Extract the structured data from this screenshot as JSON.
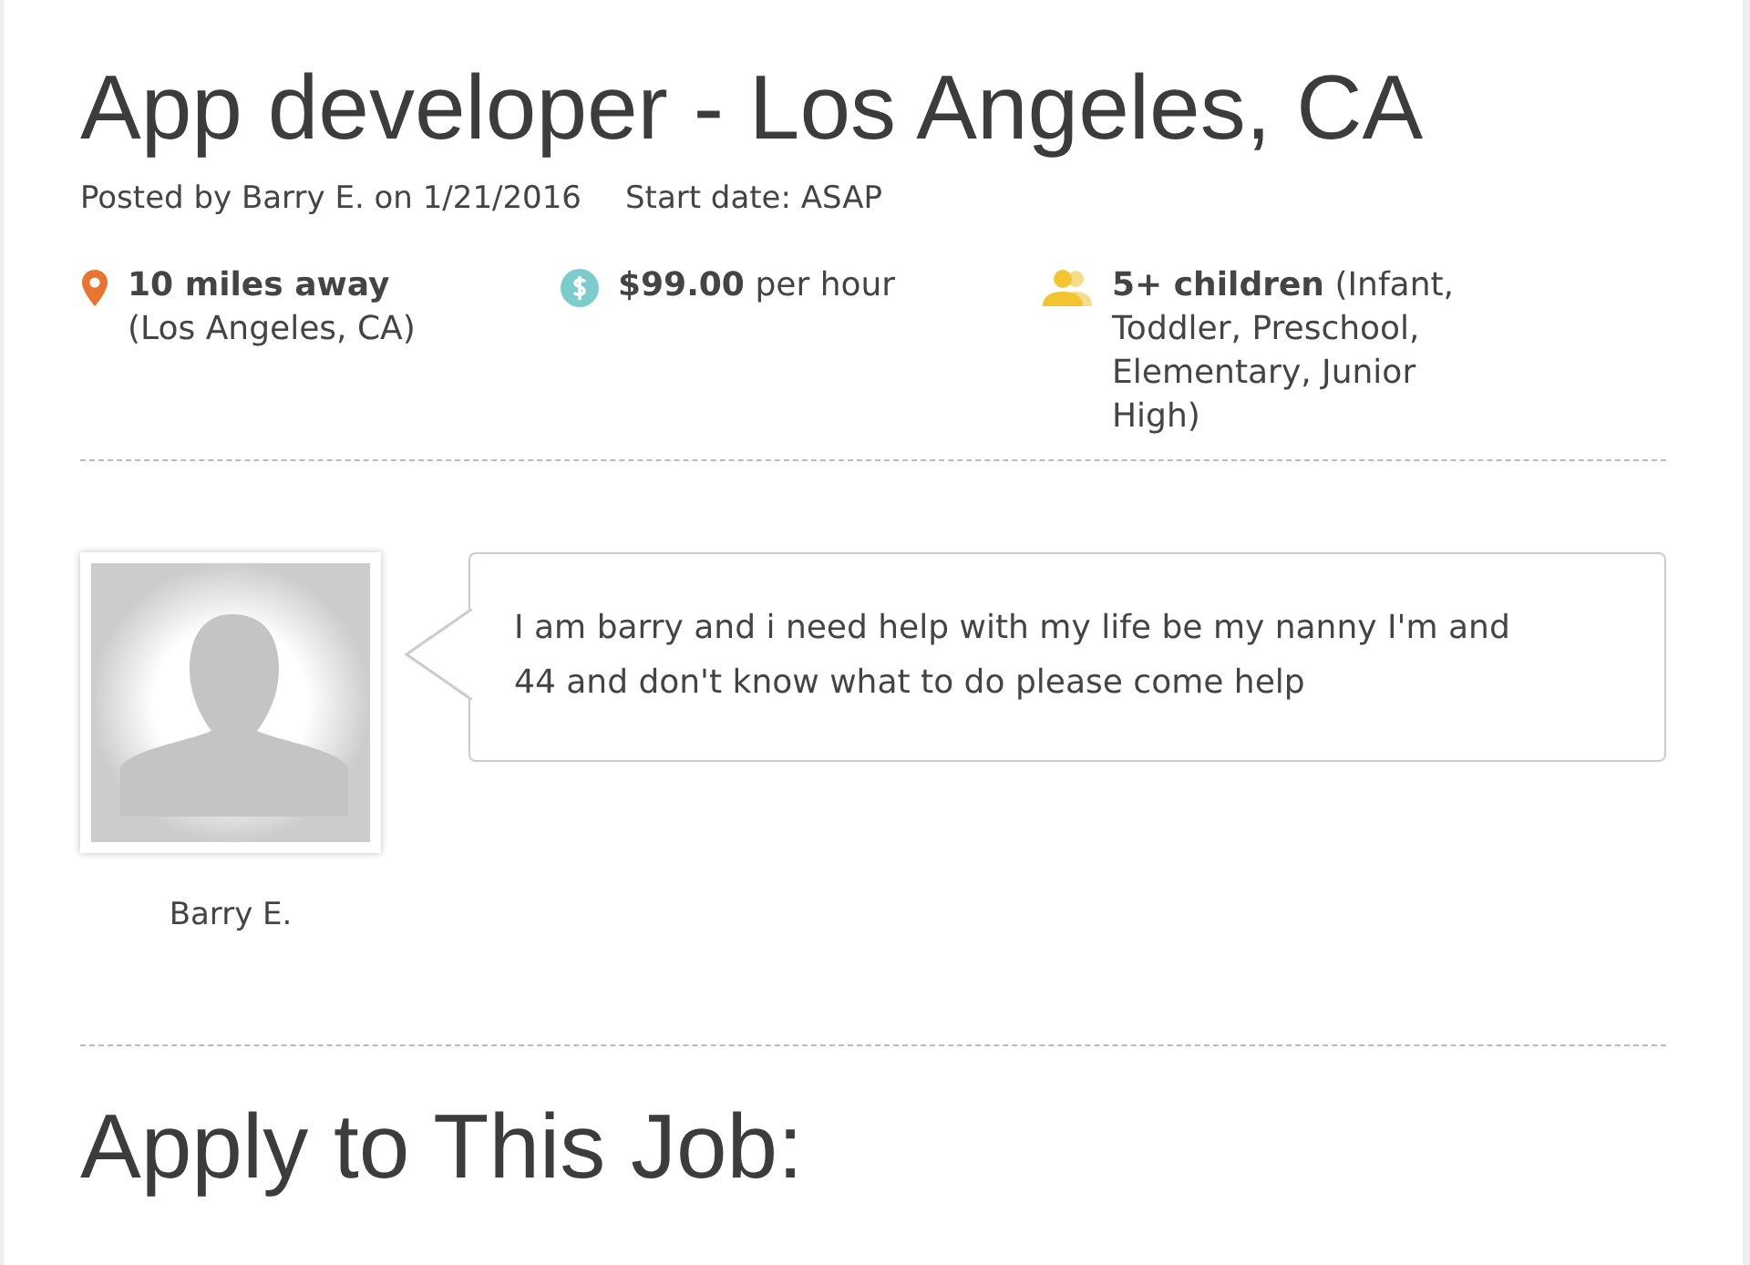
{
  "job": {
    "title": "App developer - Los Angeles, CA",
    "posted": "Posted by Barry E. on 1/21/2016",
    "start_date": "Start date: ASAP"
  },
  "details": [
    {
      "kind": "distance",
      "strong": "10 miles away",
      "text": "(Los Angeles, CA)"
    },
    {
      "kind": "rate",
      "strong": "$99.00",
      "text": "per hour"
    },
    {
      "kind": "children",
      "strong": "5+ children",
      "text": "(Infant, Toddler, Preschool, Elementary, Junior High)"
    }
  ],
  "poster": {
    "name": "Barry E.",
    "message": "I am barry and i need help with my life be my nanny I'm and 44 and don't know what to do please come help"
  },
  "apply_heading": "Apply to This Job:"
}
